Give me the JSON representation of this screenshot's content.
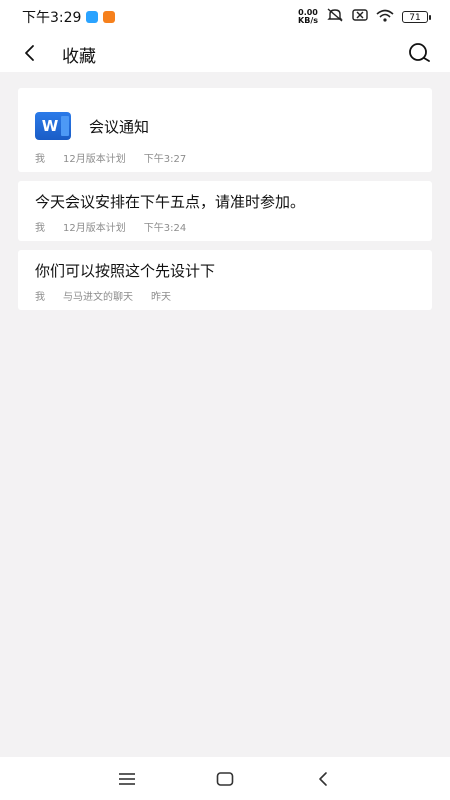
{
  "status_bar": {
    "time": "下午3:29",
    "net_speed_value": "0.00",
    "net_speed_unit": "KB/s",
    "battery": "71"
  },
  "header": {
    "title": "收藏"
  },
  "favorites": [
    {
      "type": "file",
      "file_icon_letter": "W",
      "title": "会议通知",
      "sender": "我",
      "source": "12月版本计划",
      "time": "下午3:27"
    },
    {
      "type": "text",
      "title": "今天会议安排在下午五点，请准时参加。",
      "sender": "我",
      "source": "12月版本计划",
      "time": "下午3:24"
    },
    {
      "type": "text",
      "title": "你们可以按照这个先设计下",
      "sender": "我",
      "source": "与马进文的聊天",
      "time": "昨天"
    }
  ]
}
